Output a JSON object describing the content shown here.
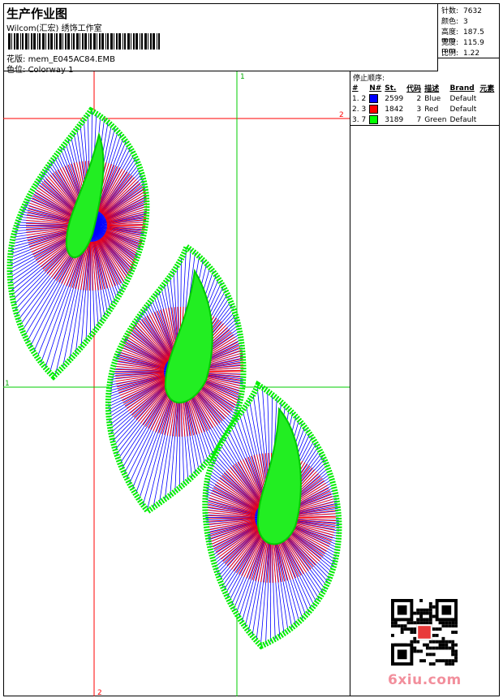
{
  "header": {
    "title": "生产作业图",
    "company": "Wilcom(汇宏) 绣饰工作室",
    "design_label": "花版:",
    "design_value": "mem_E045AC84.EMB",
    "colorway_label": "色位:",
    "colorway_value": "Colorway 1"
  },
  "stats": [
    {
      "label": "针数:",
      "value": "7632"
    },
    {
      "label": "颜色:",
      "value": "3"
    },
    {
      "label": "高度:",
      "value": "187.5 mm"
    },
    {
      "label": "宽度:",
      "value": "115.9 mm"
    },
    {
      "label": "比例:",
      "value": "1.22"
    }
  ],
  "stop_sequence": {
    "title": "停止顺序:",
    "columns": [
      "#",
      "N#",
      "St.",
      "代码",
      "描述",
      "Brand",
      "元素"
    ],
    "rows": [
      {
        "n": "1. 2",
        "color": "#0000ff",
        "st": "2599",
        "code": "2",
        "desc": "Blue",
        "brand": "Default"
      },
      {
        "n": "2. 3",
        "color": "#ff0000",
        "st": "1842",
        "code": "3",
        "desc": "Red",
        "brand": "Default"
      },
      {
        "n": "3. 7",
        "color": "#00ff00",
        "st": "3189",
        "code": "7",
        "desc": "Green",
        "brand": "Default"
      }
    ]
  },
  "guides": {
    "h1_label": "1",
    "h2_label": "2",
    "v1_label": "1",
    "v2_label": "2",
    "h_color": "#ff0000",
    "v_color": "#00cc00"
  },
  "watermark": "6xiu.com"
}
